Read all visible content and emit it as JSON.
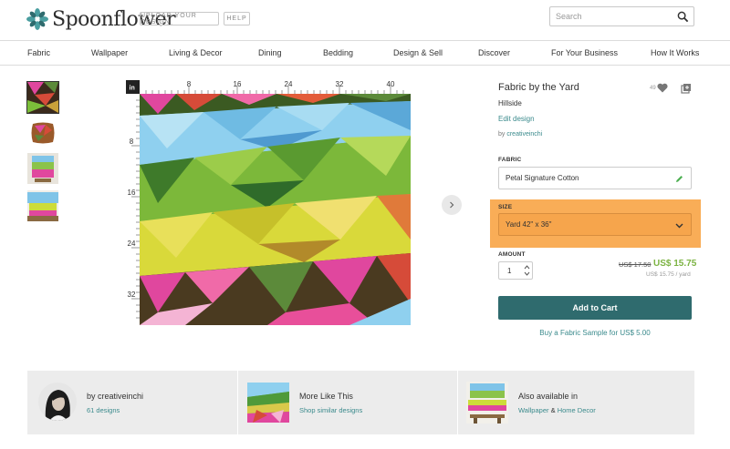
{
  "header": {
    "logo_text": "Spoonflower",
    "upload_label": "UPLOAD YOUR DESIGN",
    "help_label": "HELP",
    "search_placeholder": "Search"
  },
  "nav": {
    "items": [
      "Fabric",
      "Wallpaper",
      "Living & Decor",
      "Dining",
      "Bedding",
      "Design & Sell",
      "Discover",
      "For Your Business",
      "How It Works"
    ]
  },
  "ruler": {
    "unit": "in",
    "top_ticks": [
      "8",
      "16",
      "24",
      "32",
      "40"
    ],
    "left_ticks": [
      "8",
      "16",
      "24",
      "32"
    ]
  },
  "product": {
    "title": "Fabric by the Yard",
    "design_name": "Hillside",
    "edit_link": "Edit design",
    "by_prefix": "by ",
    "designer": "creativeinchi",
    "fav_count": "49",
    "fabric_label": "FABRIC",
    "fabric_value": "Petal Signature Cotton",
    "size_label": "SIZE",
    "size_value": "Yard 42\" x 36\"",
    "amount_label": "AMOUNT",
    "quantity": "1",
    "old_price": "US$ 17.50",
    "new_price": "US$ 15.75",
    "per_unit": "US$ 15.75 / yard",
    "cart_label": "Add to Cart",
    "sample_link": "Buy a Fabric Sample for US$ 5.00"
  },
  "bottom": {
    "designer_title": "by creativeinchi",
    "designer_link": "61 designs",
    "more_title": "More Like This",
    "more_link": "Shop similar designs",
    "avail_title": "Also available in",
    "avail_link1": "Wallpaper",
    "avail_amp": "&",
    "avail_link2": "Home Decor"
  },
  "colors": {
    "accent": "#3a8a8c",
    "cart_button": "#2f6b6e",
    "sale_price": "#7cb342",
    "highlight": "#f9ad57"
  }
}
